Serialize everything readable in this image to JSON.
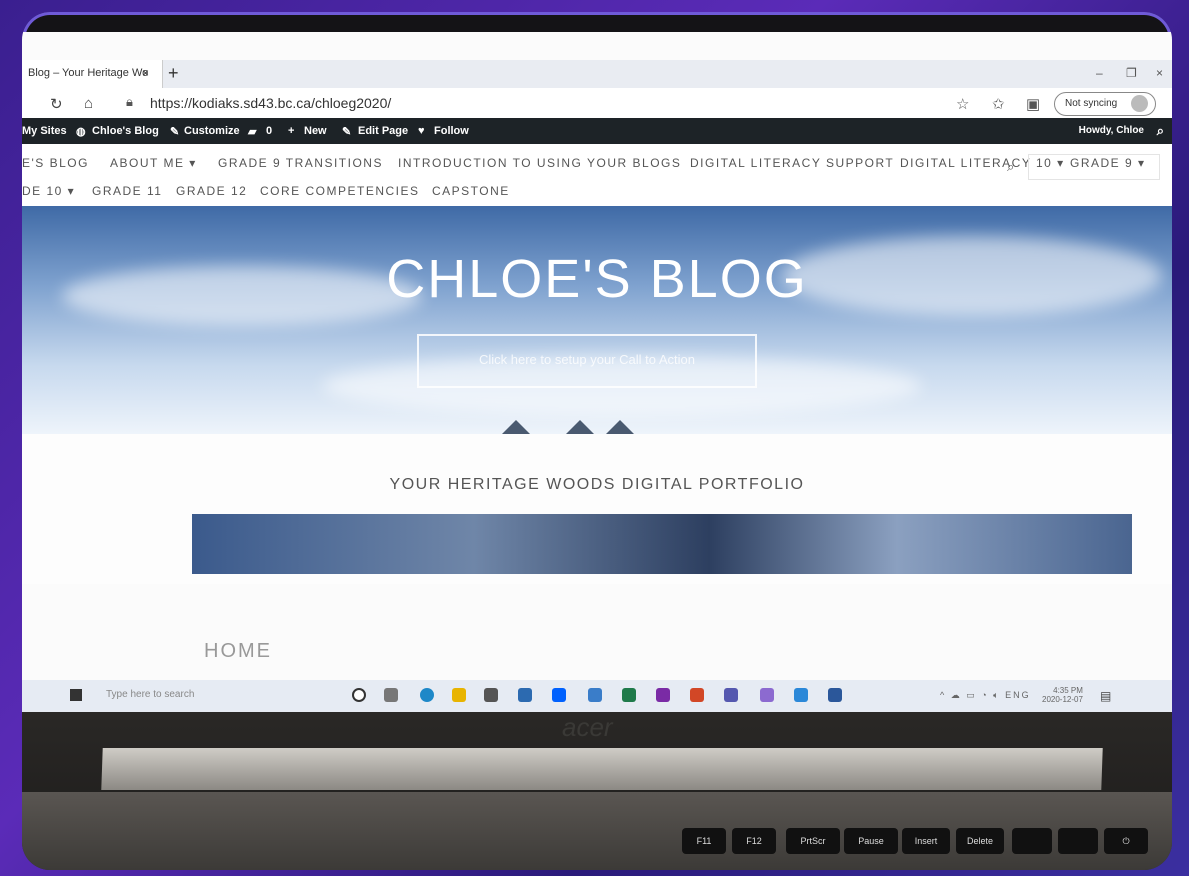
{
  "browser": {
    "tab_title": "Blog – Your Heritage Wo",
    "tab_close": "×",
    "new_tab": "+",
    "url": "https://kodiaks.sd43.bc.ca/chloeg2020/",
    "sync_label": "Not syncing",
    "min": "–",
    "restore": "❐",
    "close": "×"
  },
  "wp_admin": {
    "my_sites": "My Sites",
    "site_name": "Chloe's Blog",
    "customize": "Customize",
    "comments": "0",
    "new": "New",
    "edit_page": "Edit Page",
    "follow": "Follow",
    "howdy": "Howdy, Chloe"
  },
  "nav": {
    "items_row1": [
      "E'S BLOG",
      "ABOUT ME ▾",
      "GRADE 9 TRANSITIONS",
      "INTRODUCTION TO USING YOUR BLOGS",
      "DIGITAL LITERACY SUPPORT",
      "DIGITAL LITERACY 10 ▾",
      "GRADE 9 ▾"
    ],
    "items_row2": [
      "DE 10 ▾",
      "GRADE 11",
      "GRADE 12",
      "CORE COMPETENCIES",
      "CAPSTONE"
    ]
  },
  "hero": {
    "title": "CHLOE'S BLOG",
    "cta": "Click here to setup your Call to Action"
  },
  "tagline": "YOUR HERITAGE WOODS DIGITAL PORTFOLIO",
  "page_heading": "HOME",
  "taskbar": {
    "search_placeholder": "Type here to search",
    "lang": "ENG",
    "time": "4:35 PM",
    "date": "2020-12-07"
  },
  "laptop": {
    "brand": "acer",
    "keys": [
      "F11",
      "F12",
      "PrtScr",
      "Pause",
      "Insert",
      "Delete"
    ]
  },
  "colors": {
    "wp_admin_bg": "#1d2327",
    "frame_purple": "#5b2bb8",
    "hero_sky": "#7fa2cf"
  }
}
